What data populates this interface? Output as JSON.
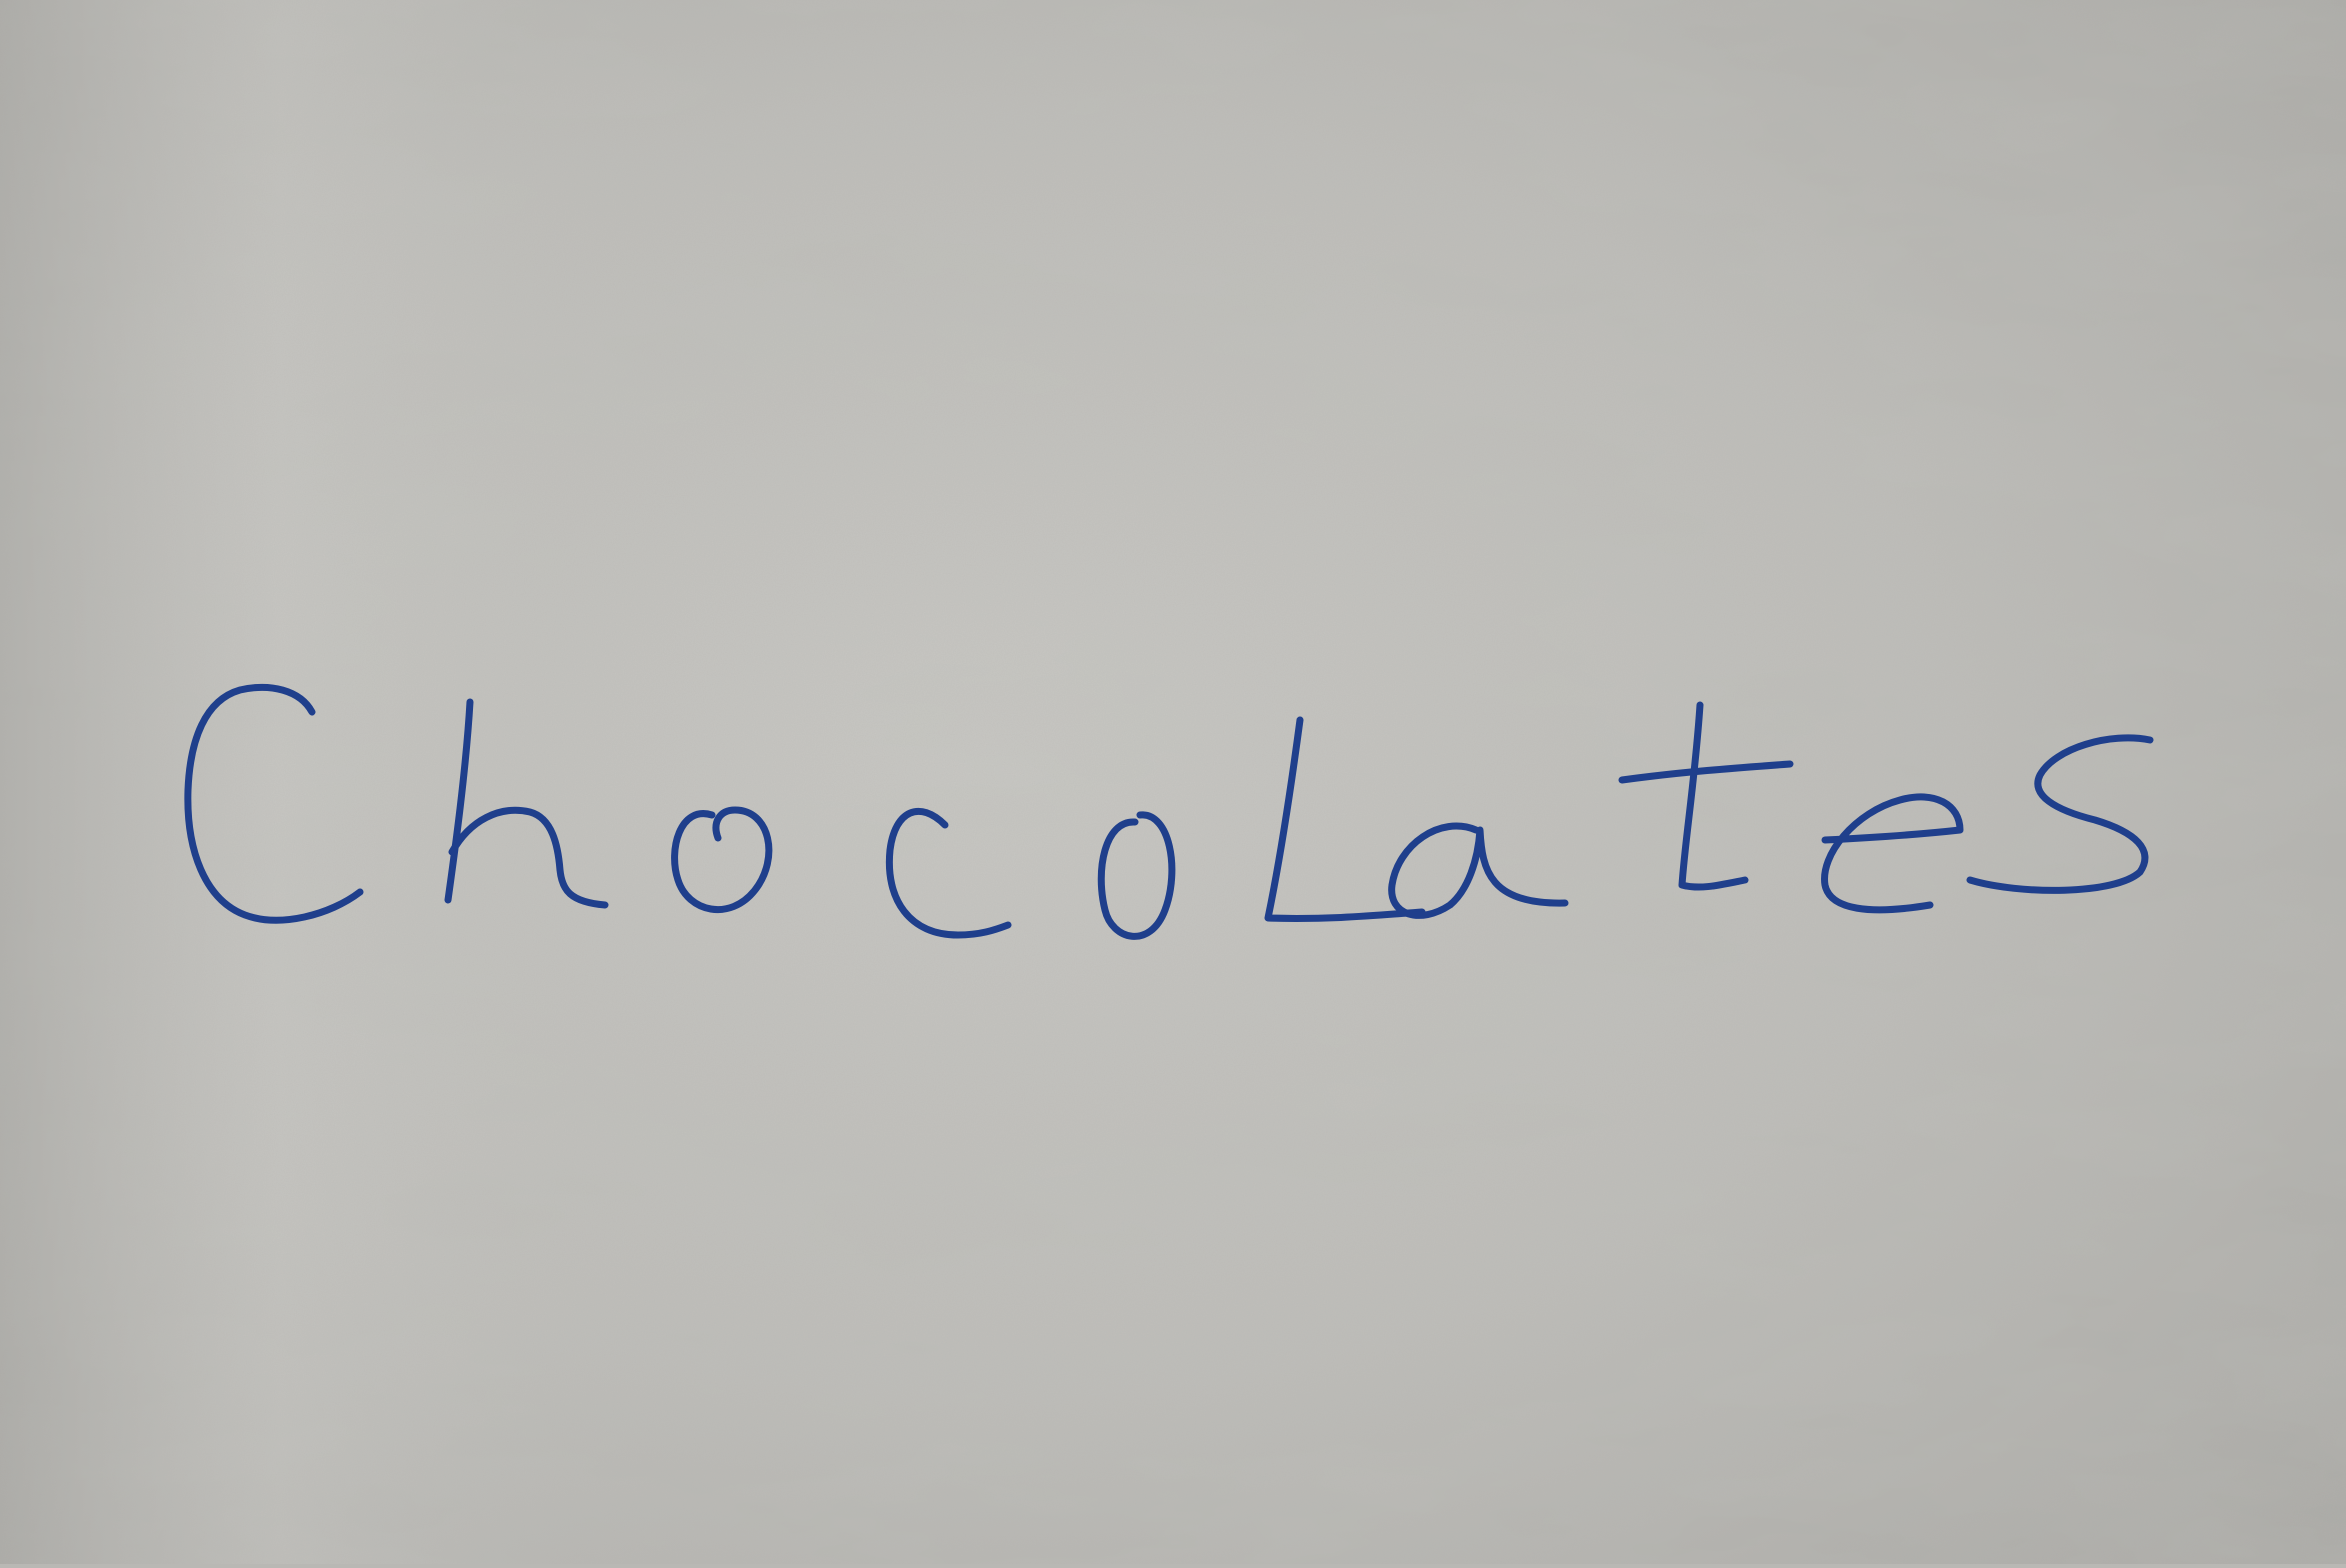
{
  "photo": {
    "handwritten_word": "Chocolates",
    "ink_color": "#1f3f8c",
    "paper_color": "#bdbcb8"
  }
}
